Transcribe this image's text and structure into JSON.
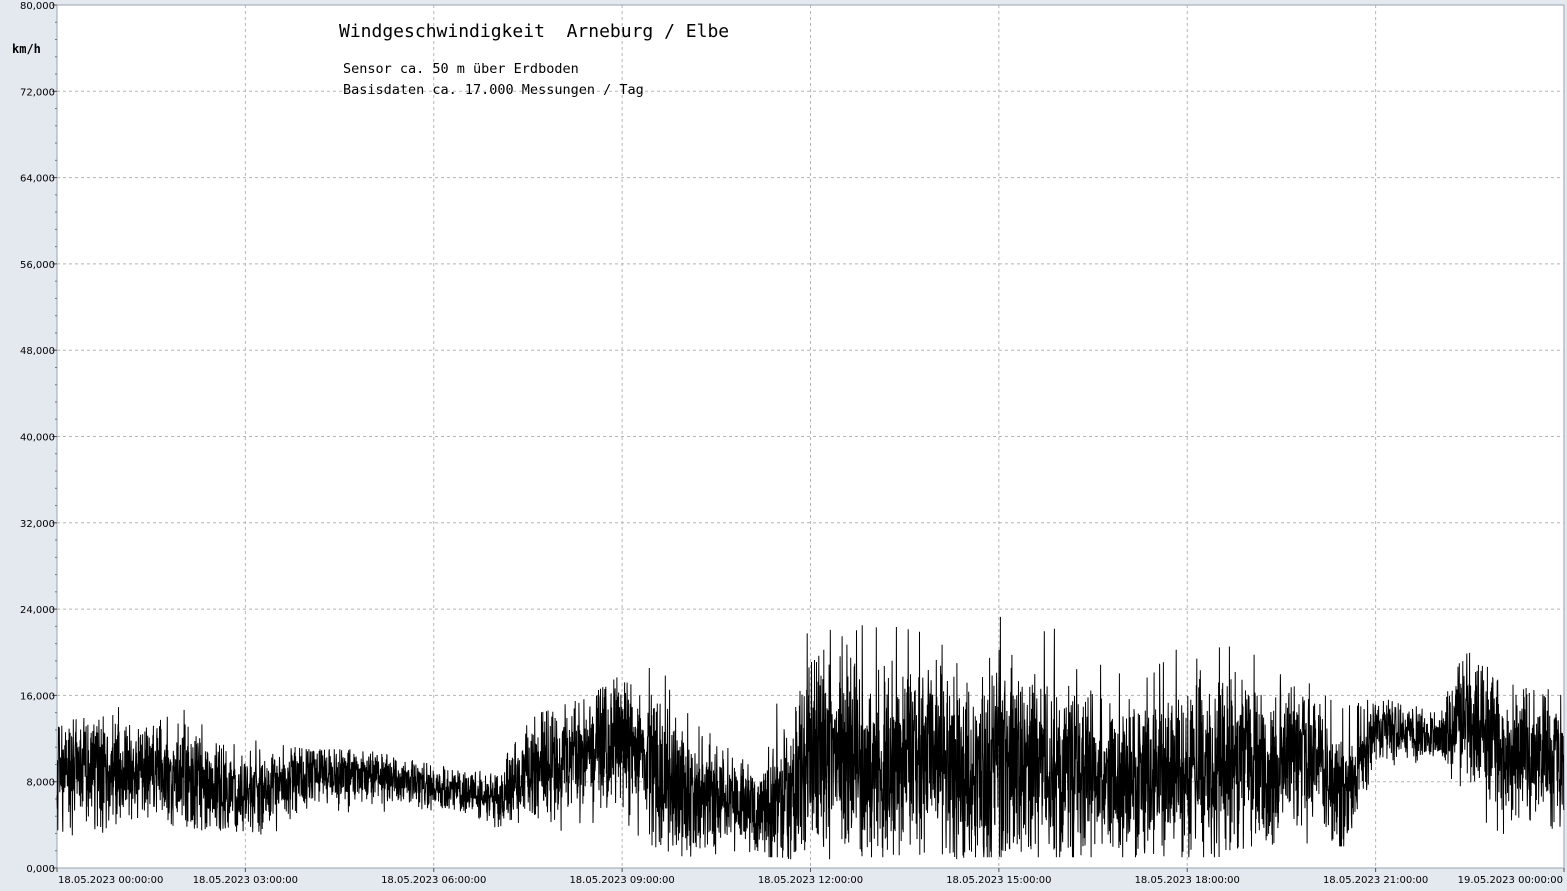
{
  "chart_data": {
    "type": "line",
    "title": "Windgeschwindigkeit  Arneburg / Elbe",
    "subtitle_lines": [
      "Sensor ca. 50 m über Erdboden",
      "Basisdaten ca. 17.000 Messungen / Tag"
    ],
    "ylabel": "km/h",
    "xlabel": "",
    "ylim": [
      0,
      80
    ],
    "ytick_values": [
      0,
      8,
      16,
      24,
      32,
      40,
      48,
      56,
      64,
      72,
      80
    ],
    "ytick_labels": [
      "0,000",
      "8,000",
      "16,000",
      "24,000",
      "32,000",
      "40,000",
      "48,000",
      "56,000",
      "64,000",
      "72,000",
      "80,000"
    ],
    "xlim_hours": [
      0,
      24
    ],
    "xtick_hours": [
      0,
      3,
      6,
      9,
      12,
      15,
      18,
      21,
      24
    ],
    "xtick_labels": [
      "18.05.2023  00:00:00",
      "18.05.2023  03:00:00",
      "18.05.2023  06:00:00",
      "18.05.2023  09:00:00",
      "18.05.2023  12:00:00",
      "18.05.2023  15:00:00",
      "18.05.2023  18:00:00",
      "18.05.2023  21:00:00",
      "19.05.2023  00:00:00"
    ],
    "grid": true,
    "series": [
      {
        "values_note": "",
        "x_hours": [
          0,
          0.5,
          1,
          1.5,
          2,
          2.5,
          3,
          3.5,
          4,
          4.5,
          5,
          5.5,
          6,
          6.5,
          7,
          7.5,
          8,
          8.5,
          9,
          9.5,
          10,
          10.5,
          11,
          11.5,
          12,
          12.5,
          13,
          13.5,
          14,
          14.5,
          15,
          15.5,
          16,
          16.5,
          17,
          17.5,
          18,
          18.5,
          19,
          19.5,
          20,
          20.5,
          21,
          21.5,
          22,
          22.5,
          23,
          23.5,
          24
        ],
        "mean": [
          9.5,
          9,
          8.5,
          9,
          8.5,
          7.5,
          7,
          7.5,
          8.5,
          8.5,
          8.5,
          8,
          7.5,
          7,
          6.5,
          8.5,
          10,
          10.5,
          12,
          9,
          6.5,
          7,
          5.5,
          6,
          10,
          11,
          9,
          10,
          10,
          9,
          10,
          10,
          9,
          9,
          8,
          8,
          9,
          10,
          9.5,
          10,
          10.5,
          6,
          13,
          12.5,
          12,
          14,
          11,
          10.5,
          10
        ],
        "min": [
          3,
          3,
          3.5,
          3,
          3.5,
          3,
          2.5,
          3,
          4,
          5,
          5,
          5,
          5,
          4,
          3,
          2,
          3,
          3,
          4,
          2,
          1,
          1,
          1,
          1,
          0.5,
          1,
          1,
          1,
          0.5,
          1,
          1,
          1,
          1,
          1,
          1,
          1,
          1,
          1,
          2,
          2,
          2,
          2,
          9,
          9,
          10,
          5,
          3,
          3,
          3
        ],
        "max": [
          14,
          15,
          15,
          13,
          15.5,
          12,
          12,
          11.5,
          11,
          11,
          11,
          10,
          10,
          9,
          9,
          14,
          15,
          16,
          18,
          20,
          15,
          12,
          10,
          16,
          23,
          22,
          23,
          23.5,
          21,
          22,
          24,
          23,
          22,
          20,
          18,
          19,
          22,
          21,
          21,
          18,
          17,
          15,
          16,
          15,
          15,
          22,
          17,
          17,
          17
        ]
      }
    ]
  }
}
